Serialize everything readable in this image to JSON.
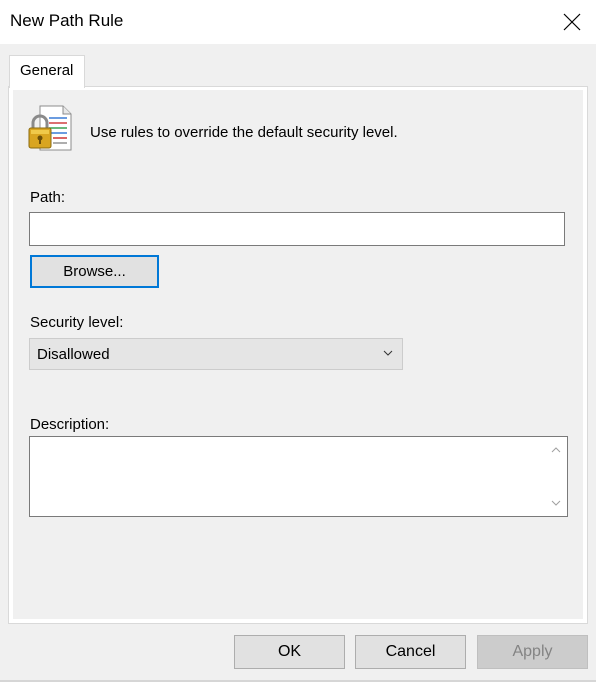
{
  "window": {
    "title": "New Path Rule"
  },
  "tabs": [
    {
      "label": "General",
      "selected": true
    }
  ],
  "info": {
    "icon": "lock-document-icon",
    "text": "Use rules to override the default security level."
  },
  "path": {
    "label": "Path:",
    "value": "",
    "browse_label": "Browse..."
  },
  "security": {
    "label": "Security level:",
    "selected": "Disallowed"
  },
  "description": {
    "label": "Description:",
    "value": ""
  },
  "footer": {
    "ok_label": "OK",
    "cancel_label": "Cancel",
    "apply_label": "Apply",
    "apply_enabled": false
  },
  "colors": {
    "focus_border": "#0078d7",
    "dialog_bg": "#f0f0f0",
    "disabled_text": "#838383"
  }
}
